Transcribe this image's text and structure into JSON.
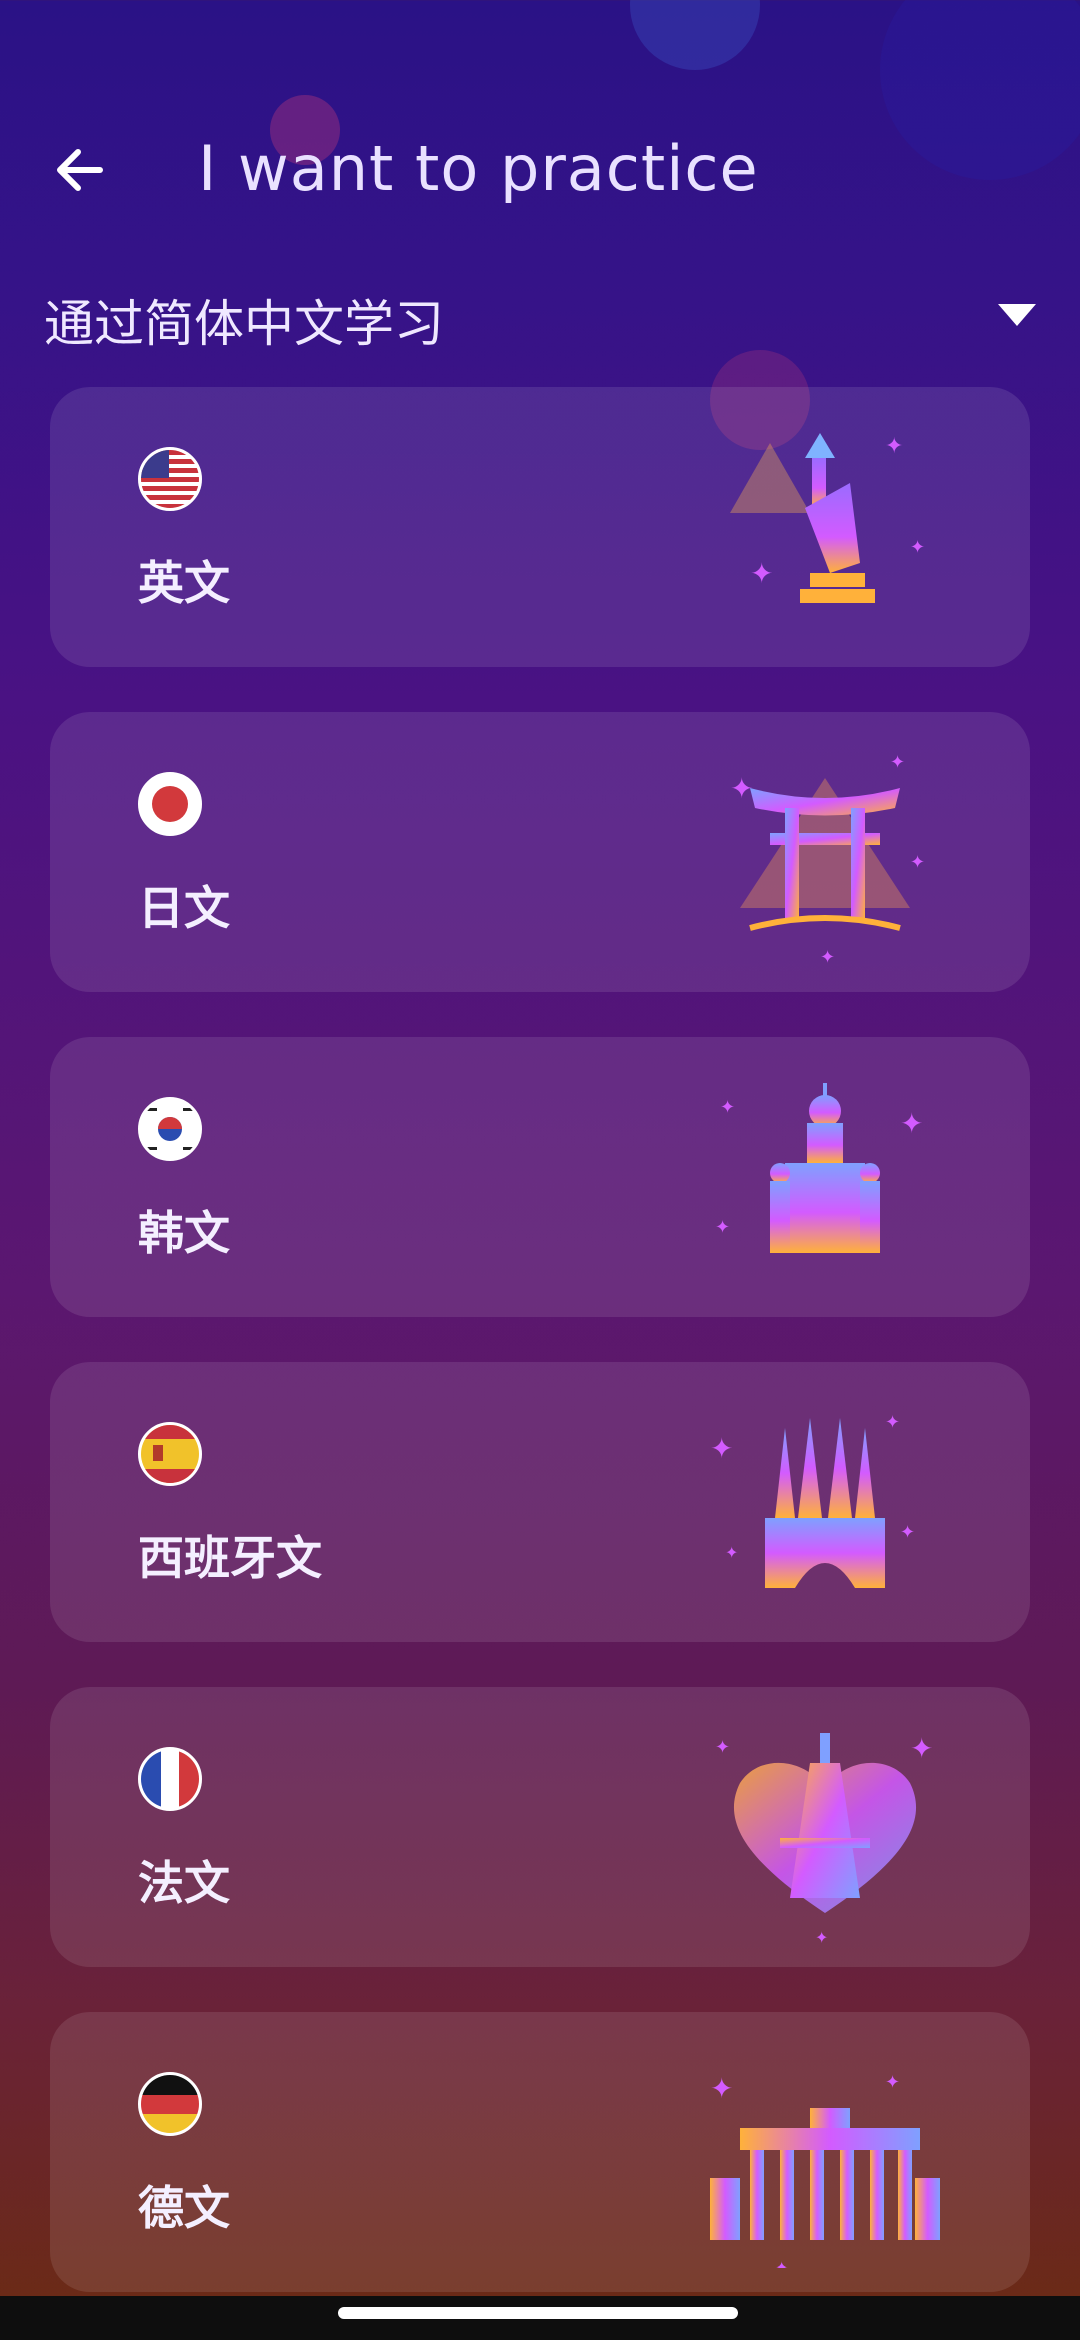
{
  "header": {
    "title": "I want to practice"
  },
  "source_language": {
    "label": "通过简体中文学习"
  },
  "languages": [
    {
      "label": "英文",
      "flag": "us-flag-icon",
      "landmark": "statue-of-liberty-icon"
    },
    {
      "label": "日文",
      "flag": "japan-flag-icon",
      "landmark": "torii-gate-icon"
    },
    {
      "label": "韩文",
      "flag": "korea-flag-icon",
      "landmark": "palace-icon"
    },
    {
      "label": "西班牙文",
      "flag": "spain-flag-icon",
      "landmark": "sagrada-familia-icon"
    },
    {
      "label": "法文",
      "flag": "france-flag-icon",
      "landmark": "eiffel-tower-icon"
    },
    {
      "label": "德文",
      "flag": "germany-flag-icon",
      "landmark": "brandenburg-gate-icon"
    }
  ],
  "colors": {
    "accent_pink": "#d35bff",
    "accent_orange": "#ffb13a",
    "accent_purple": "#8b5cff"
  }
}
